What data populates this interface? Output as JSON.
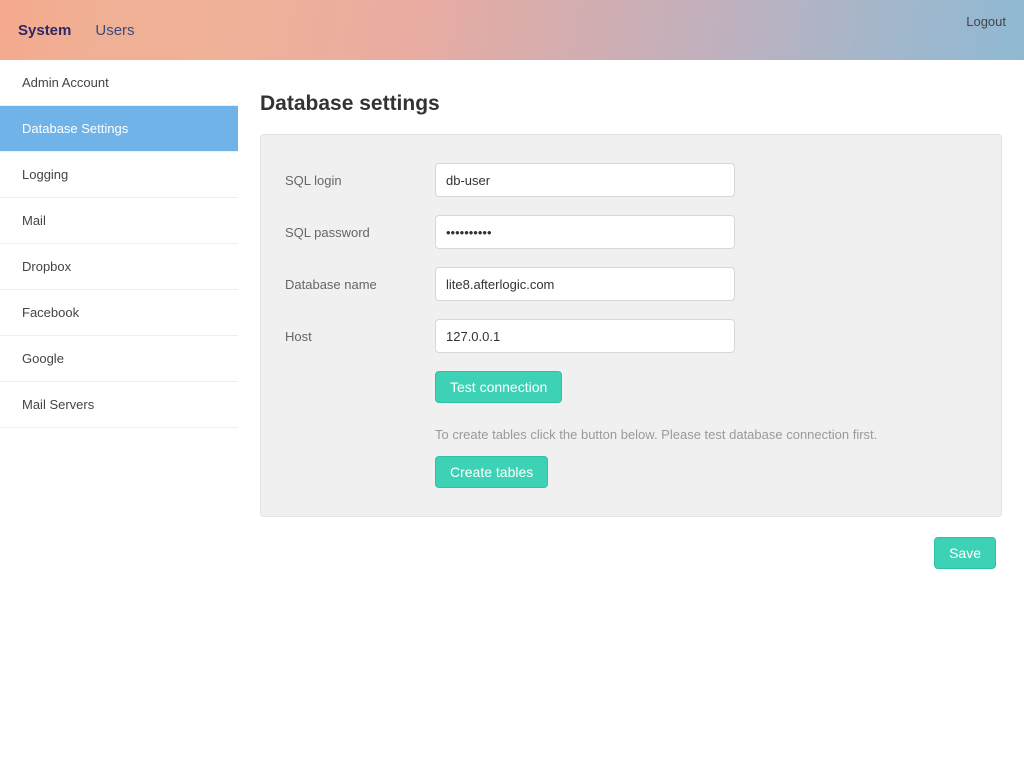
{
  "header": {
    "tabs": [
      {
        "label": "System",
        "active": true
      },
      {
        "label": "Users",
        "active": false
      }
    ],
    "logout_label": "Logout"
  },
  "sidebar": {
    "items": [
      {
        "label": "Admin Account",
        "active": false
      },
      {
        "label": "Database Settings",
        "active": true
      },
      {
        "label": "Logging",
        "active": false
      },
      {
        "label": "Mail",
        "active": false
      },
      {
        "label": "Dropbox",
        "active": false
      },
      {
        "label": "Facebook",
        "active": false
      },
      {
        "label": "Google",
        "active": false
      },
      {
        "label": "Mail Servers",
        "active": false
      }
    ]
  },
  "main": {
    "title": "Database settings",
    "form": {
      "sql_login": {
        "label": "SQL login",
        "value": "db-user"
      },
      "sql_password": {
        "label": "SQL password",
        "value": "••••••••••"
      },
      "database_name": {
        "label": "Database name",
        "value": "lite8.afterlogic.com"
      },
      "host": {
        "label": "Host",
        "value": "127.0.0.1"
      }
    },
    "test_connection_label": "Test connection",
    "hint_text": "To create tables click the button below. Please test database connection first.",
    "create_tables_label": "Create tables",
    "save_label": "Save"
  }
}
